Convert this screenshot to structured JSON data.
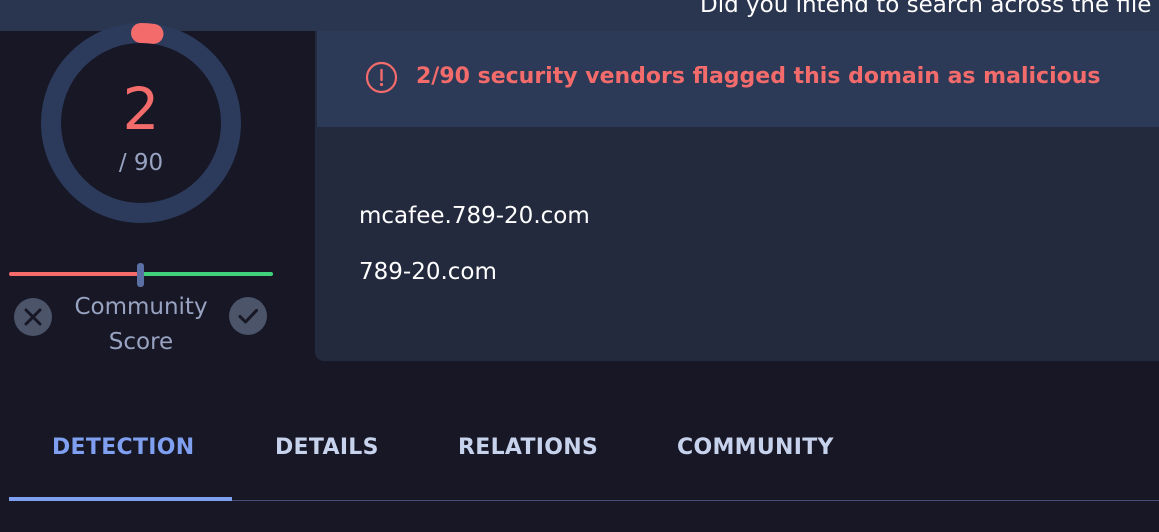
{
  "banner": {
    "text": "Did you intend to search across the file c"
  },
  "score": {
    "detected": "2",
    "total": "/ 90",
    "ratio": 0.0222,
    "colors": {
      "ring": "#2c3b5c",
      "flag": "#f36b6b"
    }
  },
  "community_score": {
    "label_line1": "Community",
    "label_line2": "Score",
    "value_fraction": 0.5,
    "icons": {
      "downvote": "close-icon",
      "upvote": "check-icon"
    }
  },
  "detection": {
    "alert_icon": "exclamation-circle-icon",
    "alert_text": "2/90 security vendors flagged this domain as malicious",
    "domains": [
      "mcafee.789-20.com",
      "789-20.com"
    ]
  },
  "tabs": [
    {
      "label": "DETECTION",
      "active": true
    },
    {
      "label": "DETAILS",
      "active": false
    },
    {
      "label": "RELATIONS",
      "active": false
    },
    {
      "label": "COMMUNITY",
      "active": false
    }
  ],
  "colors": {
    "background": "#171725",
    "card": "#232a3e",
    "card_header": "#2d3a57",
    "malicious": "#f36b6b",
    "harmless": "#3fd27b",
    "active_tab": "#7f9ff0"
  }
}
